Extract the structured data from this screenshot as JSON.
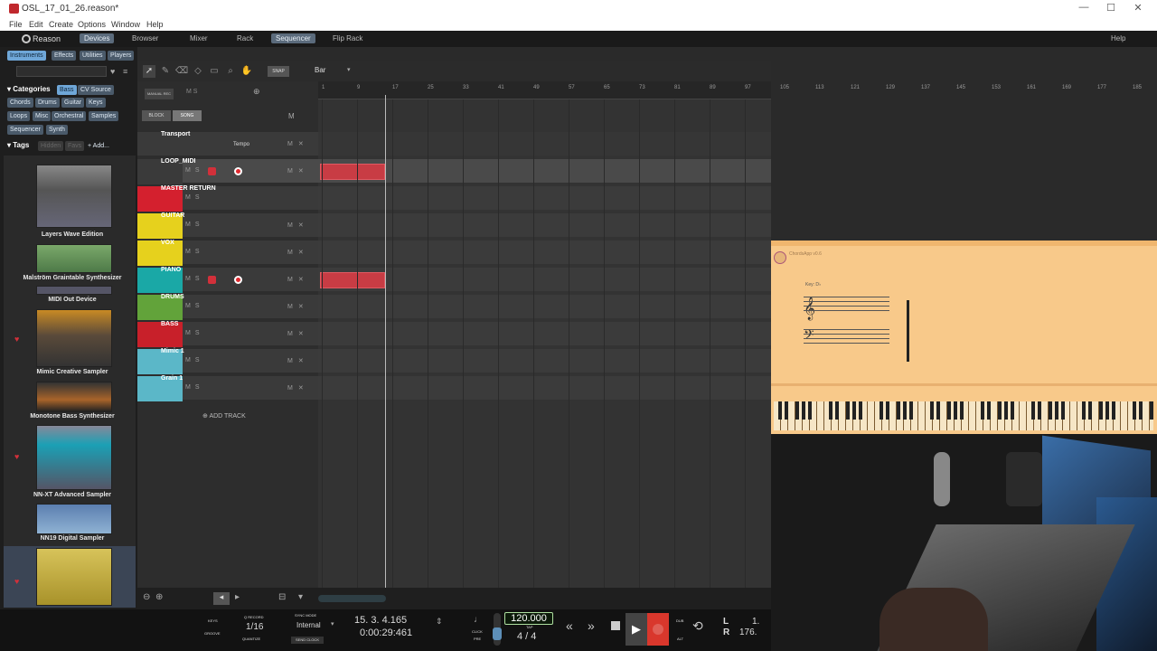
{
  "window": {
    "title": "OSL_17_01_26.reason*",
    "minimize": "—",
    "maximize": "☐",
    "close": "✕"
  },
  "menu": [
    "File",
    "Edit",
    "Create",
    "Options",
    "Window",
    "Help"
  ],
  "topnav": {
    "logo": "Reason",
    "tabs": [
      "Devices",
      "Browser",
      "Mixer",
      "Rack",
      "Sequencer",
      "Flip Rack"
    ],
    "active_tab": "Sequencer",
    "help": "Help"
  },
  "left": {
    "categories_tabs": [
      "Instruments",
      "Effects",
      "Utilities",
      "Players"
    ],
    "categories_label": "Categories",
    "category_pills": [
      "Bass",
      "CV Source",
      "Chords",
      "Drums",
      "Guitar",
      "Keys",
      "Loops",
      "Misc",
      "Orchestral",
      "Samples",
      "Sequencer",
      "Synth"
    ],
    "tags_label": "Tags",
    "tags_pills": [
      "Hidden",
      "Favs",
      "+ Add..."
    ],
    "devices": [
      "Layers Wave Edition",
      "Malström Graintable Synthesizer",
      "MIDI Out Device",
      "Mimic Creative Sampler",
      "Monotone Bass Synthesizer",
      "NN-XT Advanced Sampler",
      "NN19 Digital Sampler"
    ]
  },
  "seq_toolbar": {
    "snap": "SNAP",
    "snap_value": "Bar",
    "manual_rec": "MANUAL REC",
    "block": "BLOCK",
    "song": "SONG",
    "m": "M"
  },
  "ruler": [
    "1",
    "9",
    "17",
    "25",
    "33",
    "41",
    "49",
    "57",
    "65",
    "73",
    "81",
    "89",
    "97",
    "105",
    "113",
    "121",
    "129",
    "137",
    "145",
    "153",
    "161",
    "169",
    "177",
    "185"
  ],
  "tracks": [
    {
      "name": "Transport",
      "sub": "Tempo",
      "color": "#3a3a3a"
    },
    {
      "name": "LOOP_MIDI",
      "color": "#3a3a3a"
    },
    {
      "name": "MASTER RETURN",
      "color": "#d4202e"
    },
    {
      "name": "GUITAR",
      "color": "#e6d11d"
    },
    {
      "name": "VOX",
      "color": "#e6d11d"
    },
    {
      "name": "PIANO",
      "color": "#1aa8a6"
    },
    {
      "name": "DRUMS",
      "color": "#62a33a"
    },
    {
      "name": "BASS",
      "color": "#c8202a"
    },
    {
      "name": "Mimic 1",
      "color": "#5bb7c8"
    },
    {
      "name": "Grain 1",
      "color": "#5bb7c8"
    }
  ],
  "add_track": "ADD TRACK",
  "transport": {
    "keys": "KEYS",
    "groove": "GROOVE",
    "q_record": "Q RECORD",
    "quantize_value": "1/16",
    "quantize": "QUANTIZE",
    "sync_mode": "SYNC MODE",
    "sync_value": "Internal",
    "send_clock": "SEND CLOCK",
    "position": "15. 3. 4.165",
    "time": "0:00:29:461",
    "click": "CLICK",
    "pre": "PRE",
    "tempo": "120.000",
    "tap": "TAP",
    "signature": "4 / 4",
    "dub": "DUB",
    "alt": "ALT",
    "l_label": "L",
    "r_label": "R",
    "l_value": "1.",
    "r_value": "176."
  },
  "overlay": {
    "app_title": "ChordsApp v0.6",
    "key": "Key: D♭"
  }
}
